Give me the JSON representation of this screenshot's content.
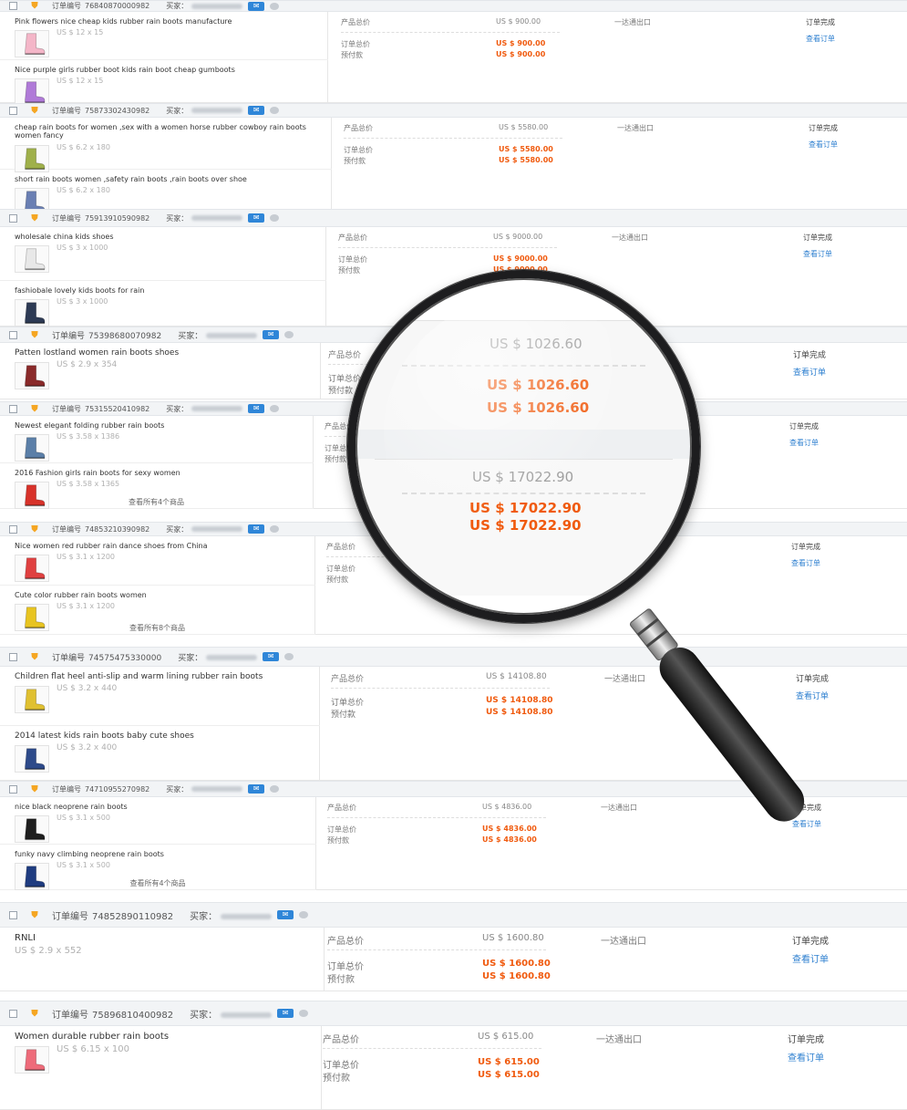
{
  "header_labels": {
    "order_no": "订单编号",
    "buyer": "买家："
  },
  "column_labels": {
    "product_total": "产品总价",
    "order_total": "订单总价",
    "prepaid": "预付款",
    "view_order": "查看订单",
    "status": "订单完成",
    "shipping": "一达通出口"
  },
  "orders": [
    {
      "order_no": "76840870000982",
      "products": [
        {
          "name": "Pink flowers nice cheap kids rubber rain boots manufacture",
          "meta": "US $ 12 x 15",
          "color": "#f4b6c8"
        },
        {
          "name": "Nice purple girls rubber boot kids rain boot cheap gumboots",
          "meta": "US $ 12 x 15",
          "color": "#b07ad8"
        }
      ],
      "product_total": "US $ 900.00",
      "order_total": "US $ 900.00",
      "prepaid": "US $ 900.00"
    },
    {
      "order_no": "75873302430982",
      "products": [
        {
          "name": "cheap rain boots for women ,sex with a women horse rubber cowboy rain boots women fancy",
          "meta": "US $ 6.2 x 180",
          "color": "#9fb04a"
        },
        {
          "name": "short rain boots women ,safety rain boots ,rain boots over shoe",
          "meta": "US $ 6.2 x 180",
          "color": "#6a7fb3"
        }
      ],
      "product_total": "US $ 5580.00",
      "order_total": "US $ 5580.00",
      "prepaid": "US $ 5580.00"
    },
    {
      "order_no": "75913910590982",
      "products": [
        {
          "name": "wholesale china kids shoes",
          "meta": "US $ 3 x 1000",
          "color": "#e8e8e8"
        },
        {
          "name": "fashiobale lovely kids boots for rain",
          "meta": "US $ 3 x 1000",
          "color": "#2d3a54"
        }
      ],
      "product_total": "US $ 9000.00",
      "order_total": "US $ 9000.00",
      "prepaid": "US $ 9000.00"
    },
    {
      "order_no": "75398680070982",
      "products": [
        {
          "name": "Patten lostland women rain boots shoes",
          "meta": "US $ 2.9 x 354",
          "color": "#8a2a2a"
        }
      ],
      "product_total": "US $ 1026.60",
      "order_total": "US $ 1026.60",
      "prepaid": "US $ 1026.60"
    },
    {
      "order_no": "75315520410982",
      "products": [
        {
          "name": "Newest elegant folding rubber rain boots",
          "meta": "US $ 3.58 x 1386",
          "color": "#5b7fa8"
        },
        {
          "name": "2016 Fashion girls rain boots for sexy women",
          "meta": "US $ 3.58 x 1365",
          "color": "#d8322a"
        }
      ],
      "see_all": "查看所有4个商品",
      "product_total": "US $ 17022.90",
      "order_total": "US $ 17022.90",
      "prepaid": "US $ 17022.90"
    },
    {
      "order_no": "74853210390982",
      "products": [
        {
          "name": "Nice women red rubber rain dance shoes from China",
          "meta": "US $ 3.1 x 1200",
          "color": "#e04040"
        },
        {
          "name": "Cute color rubber rain boots women",
          "meta": "US $ 3.1 x 1200",
          "color": "#e8c420"
        }
      ],
      "see_all": "查看所有8个商品"
    },
    {
      "order_no": "74575475330000",
      "products": [
        {
          "name": "Children flat heel anti-slip and warm lining rubber rain boots",
          "meta": "US $ 3.2 x 440",
          "color": "#e0c030"
        },
        {
          "name": "2014 latest kids rain boots baby cute shoes",
          "meta": "US $ 3.2 x 400",
          "color": "#2d4a8a"
        }
      ],
      "product_total": "US $ 14108.80",
      "order_total": "US $ 14108.80",
      "prepaid": "US $ 14108.80"
    },
    {
      "order_no": "74710955270982",
      "products": [
        {
          "name": "nice black neoprene rain boots",
          "meta": "US $ 3.1 x 500",
          "color": "#1e1e1e"
        },
        {
          "name": "funky navy climbing neoprene rain boots",
          "meta": "US $ 3.1 x 500",
          "color": "#1f3c80"
        }
      ],
      "see_all": "查看所有4个商品",
      "product_total": "US $ 4836.00",
      "order_total": "US $ 4836.00",
      "prepaid": "US $ 4836.00"
    },
    {
      "order_no": "74852890110982",
      "products": [
        {
          "name": "RNLI",
          "meta": "US $ 2.9 x 552"
        }
      ],
      "product_total": "US $ 1600.80",
      "order_total": "US $ 1600.80",
      "prepaid": "US $ 1600.80"
    },
    {
      "order_no": "75896810400982",
      "products": [
        {
          "name": "Women durable rubber rain boots",
          "meta": "US $ 6.15 x 100",
          "color": "#ee6b7a"
        }
      ],
      "product_total": "US $ 615.00",
      "order_total": "US $ 615.00",
      "prepaid": "US $ 615.00"
    }
  ],
  "magnifier": {
    "values": [
      {
        "text": "US $ 1026.60",
        "style": "grey"
      },
      {
        "text": "US $ 1026.60",
        "style": "orange"
      },
      {
        "text": "US $ 1026.60",
        "style": "orange"
      },
      {
        "text": "US $ 17022.90",
        "style": "grey"
      },
      {
        "text": "US $ 17022.90",
        "style": "orange"
      },
      {
        "text": "US $ 17022.90",
        "style": "orange"
      }
    ]
  }
}
